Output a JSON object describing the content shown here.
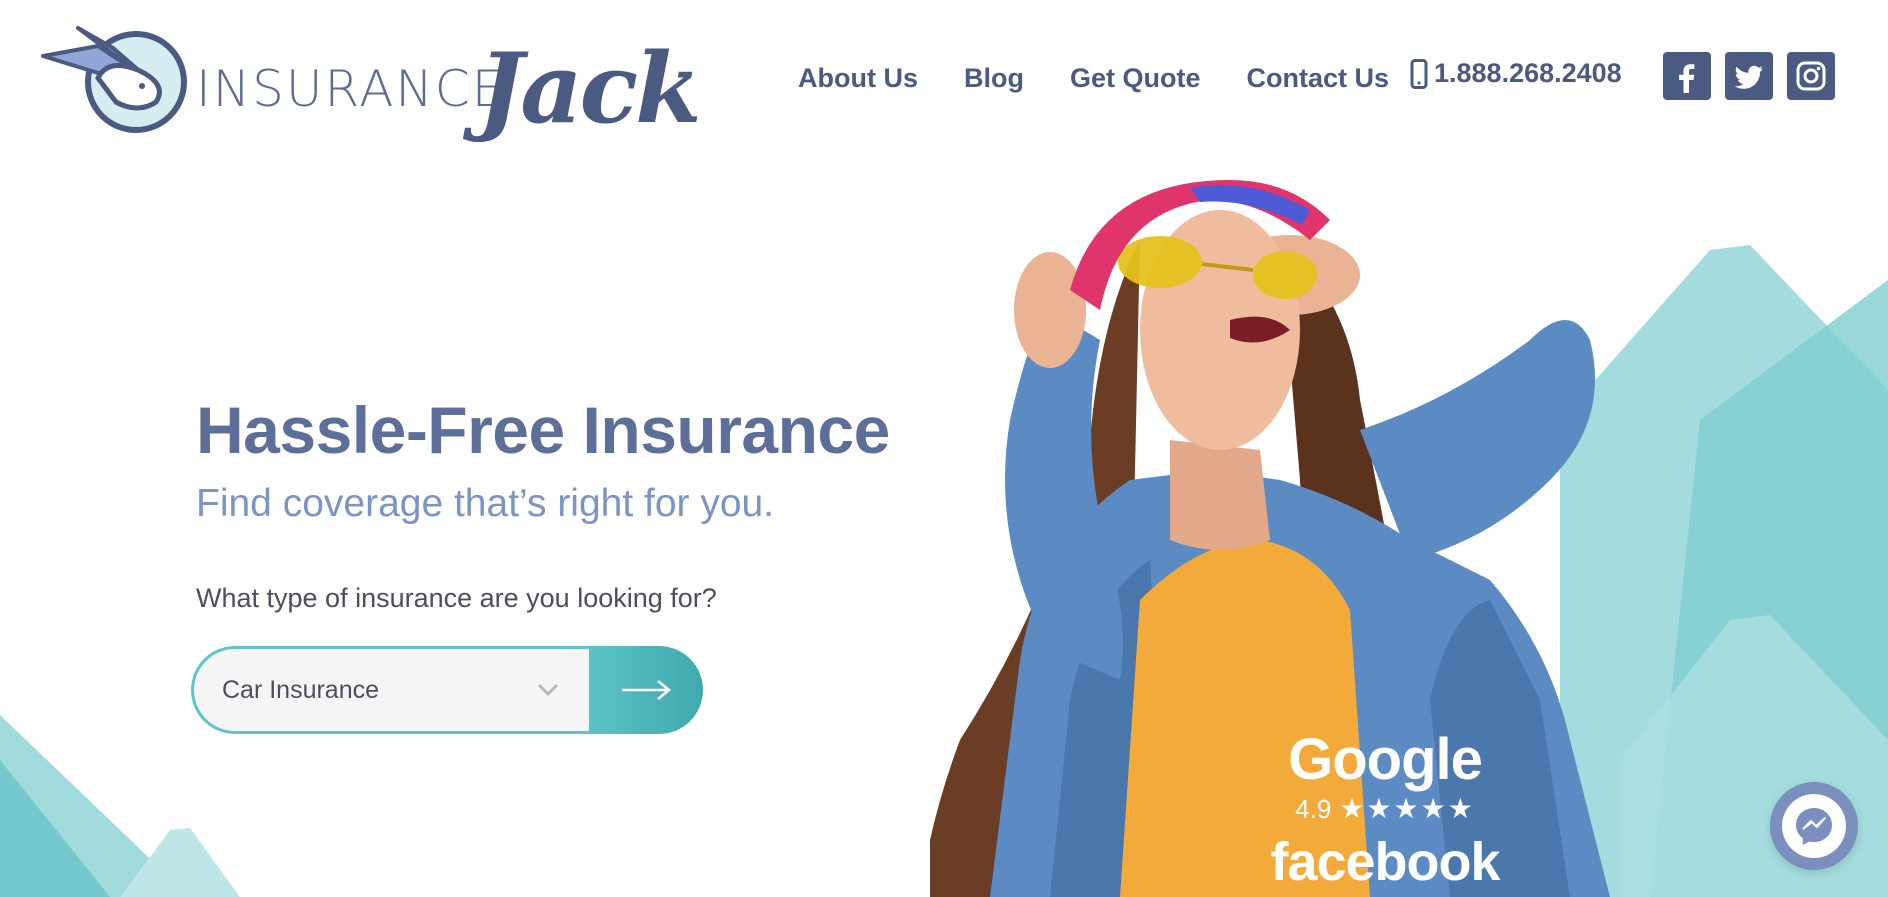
{
  "brand": {
    "word": "INSURANCE",
    "script": "Jack"
  },
  "nav": {
    "items": [
      {
        "label": "About Us"
      },
      {
        "label": "Blog"
      },
      {
        "label": "Get Quote"
      },
      {
        "label": "Contact Us"
      }
    ],
    "phone": "1.888.268.2408"
  },
  "social": {
    "icons": [
      "facebook-icon",
      "twitter-icon",
      "instagram-icon"
    ]
  },
  "hero": {
    "title": "Hassle-Free Insurance",
    "subtitle": "Find coverage that’s right for you.",
    "question": "What type of insurance are you looking for?",
    "select_value": "Car Insurance"
  },
  "ratings": {
    "google": "Google",
    "score": "4.9",
    "stars": "★★★★★",
    "facebook": "facebook"
  },
  "colors": {
    "navy": "#4a5a80",
    "teal": "#5ec4c8",
    "title": "#5d6f98",
    "subtitle": "#7b94c4"
  }
}
